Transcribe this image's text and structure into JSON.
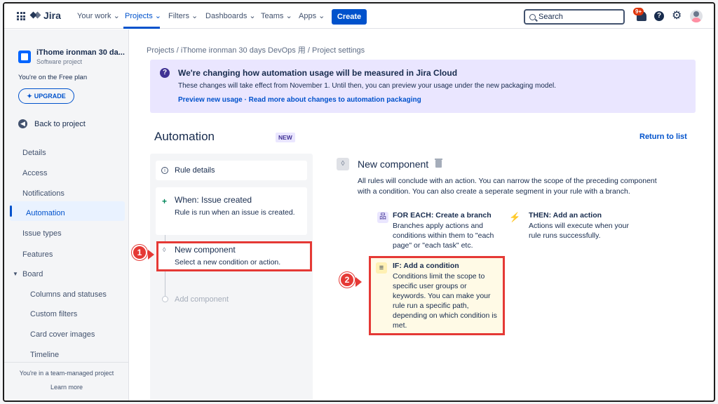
{
  "nav": {
    "app_name": "Jira",
    "your_work": "Your work",
    "projects": "Projects",
    "filters": "Filters",
    "dashboards": "Dashboards",
    "teams": "Teams",
    "apps": "Apps",
    "create": "Create",
    "search_placeholder": "Search",
    "notification_count": "9+",
    "help": "?",
    "gear": "⚙"
  },
  "sidebar": {
    "project_name": "iThome ironman 30 da...",
    "project_type": "Software project",
    "plan_note": "You're on the Free plan",
    "upgrade": "UPGRADE",
    "back": "Back to project",
    "items": [
      "Details",
      "Access",
      "Notifications",
      "Automation",
      "Issue types",
      "Features",
      "Board"
    ],
    "board_items": [
      "Columns and statuses",
      "Custom filters",
      "Card cover images",
      "Timeline"
    ],
    "team_managed": "You're in a team-managed project",
    "learn_more": "Learn more"
  },
  "breadcrumb": "Projects  /  iThome ironman 30 days DevOps 用  /  Project settings",
  "banner": {
    "icon": "?",
    "title": "We're changing how automation usage will be measured in Jira Cloud",
    "text": "These changes will take effect from November 1. Until then, you can preview your usage under the new packaging model.",
    "links": "Preview new usage · Read more about changes to automation packaging"
  },
  "automation": {
    "title": "Automation",
    "lozenge": "NEW",
    "return": "Return to list"
  },
  "rule": {
    "details": "Rule details",
    "trigger_title": "When: Issue created",
    "trigger_desc": "Rule is run when an issue is created.",
    "new_component": "New component",
    "new_component_desc": "Select a new condition or action.",
    "add_component": "Add component"
  },
  "panel": {
    "title": "New component",
    "desc": "All rules will conclude with an action. You can narrow the scope of the preceding component with a condition. You can also create a seperate segment in your rule with a branch.",
    "foreach_title": "FOR EACH: Create a branch",
    "foreach_desc": "Branches apply actions and conditions within them to \"each page\" or \"each task\" etc.",
    "then_title": "THEN: Add an action",
    "then_desc": "Actions will execute when your rule runs successfully.",
    "if_title": "IF: Add a condition",
    "if_desc": "Conditions limit the scope to specific user groups or keywords. You can make your rule run a specific path, depending on which condition is met."
  },
  "callouts": [
    "1",
    "2"
  ],
  "colors": {
    "accent": "#0052cc",
    "highlight": "#e53935",
    "banner": "#eae6ff"
  }
}
